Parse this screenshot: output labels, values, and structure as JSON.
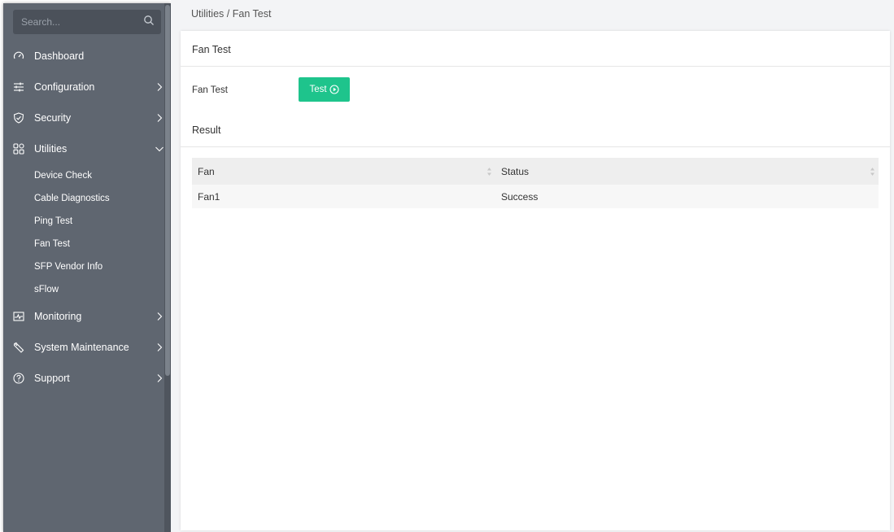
{
  "search": {
    "placeholder": "Search..."
  },
  "sidebar": {
    "items": [
      {
        "label": "Dashboard",
        "icon": "dashboard-icon",
        "has_chevron": false
      },
      {
        "label": "Configuration",
        "icon": "sliders-icon",
        "has_chevron": true
      },
      {
        "label": "Security",
        "icon": "shield-icon",
        "has_chevron": true
      },
      {
        "label": "Utilities",
        "icon": "grid-icon",
        "has_chevron": true,
        "expanded": true
      },
      {
        "label": "Monitoring",
        "icon": "monitor-icon",
        "has_chevron": true
      },
      {
        "label": "System Maintenance",
        "icon": "wrench-icon",
        "has_chevron": true
      },
      {
        "label": "Support",
        "icon": "help-icon",
        "has_chevron": true
      }
    ],
    "utilities_sub": [
      "Device Check",
      "Cable Diagnostics",
      "Ping Test",
      "Fan Test",
      "SFP Vendor Info",
      "sFlow"
    ]
  },
  "breadcrumb": {
    "parent": "Utilities",
    "separator": "/",
    "current": "Fan Test"
  },
  "panel": {
    "title": "Fan Test",
    "fan_test_label": "Fan Test",
    "test_button": "Test",
    "result_label": "Result"
  },
  "table": {
    "headers": [
      "Fan",
      "Status"
    ],
    "rows": [
      [
        "Fan1",
        "Success"
      ]
    ]
  },
  "colors": {
    "sidebar_bg": "#5f6670",
    "accent_green": "#1ec48c",
    "main_bg": "#f3f4f6"
  }
}
